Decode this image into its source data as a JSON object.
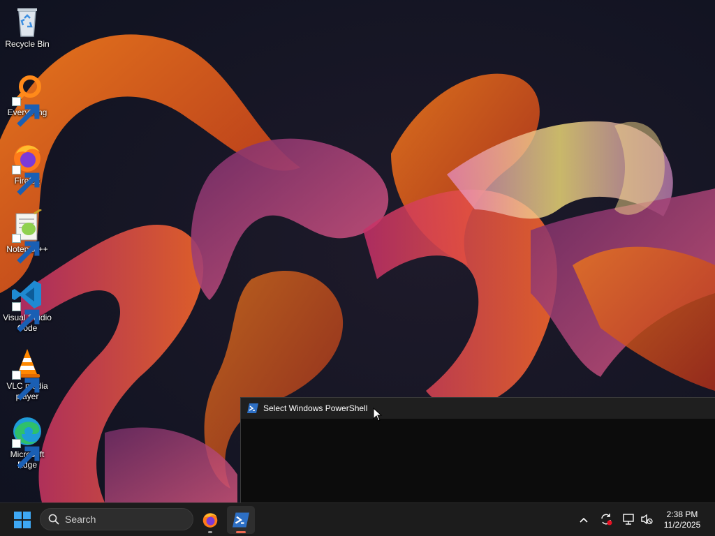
{
  "desktop": {
    "icons": [
      {
        "label": "Recycle Bin"
      },
      {
        "label": "Everything"
      },
      {
        "label": "Firefox"
      },
      {
        "label": "Notepad++"
      },
      {
        "label": "Visual Studio Code"
      },
      {
        "label": "VLC media player"
      },
      {
        "label": "Microsoft Edge"
      }
    ]
  },
  "window": {
    "title": "Select Windows PowerShell",
    "icon": "powershell-icon"
  },
  "taskbar": {
    "search_placeholder": "Search",
    "apps": [
      {
        "name": "Firefox",
        "icon": "firefox-icon",
        "running": true
      },
      {
        "name": "Windows PowerShell",
        "icon": "powershell-icon",
        "running": true,
        "active": true
      }
    ],
    "tray": {
      "icons": [
        "chevron-up-icon",
        "sync-icon",
        "network-icon",
        "volume-muted-icon"
      ]
    },
    "clock": {
      "time": "2:38 PM",
      "date": "11/2/2025"
    }
  },
  "colors": {
    "accent": "#0078d4",
    "taskbar_bg": "#1c1c1c",
    "window_bg": "#0c0c0c",
    "active_indicator": "#f06a52"
  }
}
